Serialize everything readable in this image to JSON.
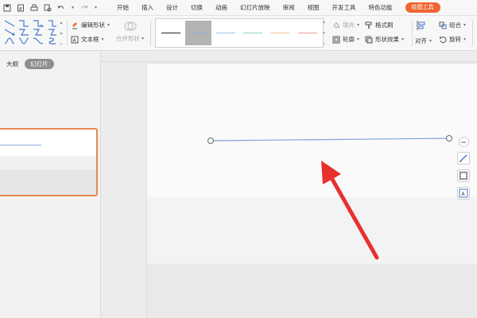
{
  "menubar": {
    "quick_access": [
      "save-icon",
      "export-pdf-icon",
      "print-icon",
      "print-preview-icon",
      "undo-icon",
      "redo-icon"
    ],
    "tabs": [
      "开始",
      "插入",
      "设计",
      "切换",
      "动画",
      "幻灯片放映",
      "审阅",
      "视图",
      "开发工具",
      "特色功能"
    ],
    "active_tab": "绘图工具"
  },
  "ribbon": {
    "edit_shape": "编辑形状",
    "text_box": "文本框",
    "merge_shapes": "合并形状",
    "fill": "填充",
    "format_painter": "格式刷",
    "outline": "轮廓",
    "shape_effects": "形状效果",
    "align": "对齐",
    "group": "组合",
    "rotate": "旋转",
    "line_styles": [
      {
        "color": "#222222",
        "selected": false
      },
      {
        "color": "#8fb3e0",
        "selected": true
      },
      {
        "color": "#9ec3ea",
        "selected": false
      },
      {
        "color": "#8fd0c8",
        "selected": false
      },
      {
        "color": "#f2c28a",
        "selected": false
      },
      {
        "color": "#ef9a9a",
        "selected": false
      }
    ]
  },
  "left_panel": {
    "tab_outline": "大纲",
    "tab_slides": "幻灯片"
  },
  "colors": {
    "accent": "#f0652f",
    "thumb_border": "#e8864f",
    "line_color": "#7fa3d8",
    "arrow_color": "#e8302c"
  }
}
